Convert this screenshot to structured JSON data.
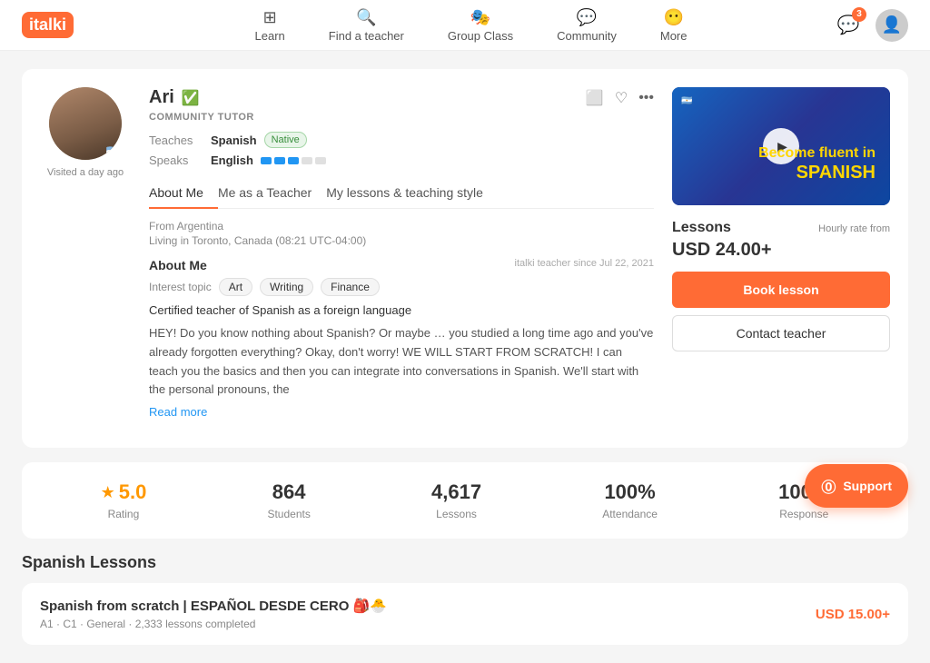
{
  "header": {
    "logo": "italki",
    "nav": [
      {
        "id": "learn",
        "label": "Learn",
        "icon": "📊"
      },
      {
        "id": "find-teacher",
        "label": "Find a teacher",
        "icon": "🔍"
      },
      {
        "id": "group-class",
        "label": "Group Class",
        "icon": "🎭"
      },
      {
        "id": "community",
        "label": "Community",
        "icon": "💬"
      },
      {
        "id": "more",
        "label": "More",
        "icon": "😶"
      }
    ],
    "notifications_count": "3"
  },
  "profile": {
    "name": "Ari",
    "verified": true,
    "tutor_type": "COMMUNITY TUTOR",
    "visited": "Visited a day ago",
    "teaches_label": "Teaches",
    "teaches_lang": "Spanish",
    "native_label": "Native",
    "speaks_label": "Speaks",
    "speaks_lang": "English",
    "flag": "🇦🇷",
    "italki_since": "italki teacher since Jul 22, 2021",
    "from": "From Argentina",
    "living": "Living in Toronto, Canada (08:21 UTC-04:00)",
    "about_title": "About Me",
    "interest_label": "Interest topic",
    "interests": [
      "Art",
      "Writing",
      "Finance"
    ],
    "certified": "Certified teacher of Spanish as a foreign language",
    "bio": "HEY! Do you know nothing about Spanish? Or maybe … you studied a long time ago and you've already forgotten everything? Okay, don't worry! WE WILL START FROM SCRATCH! I can teach you the basics and then you can integrate into conversations in Spanish. We'll start with the personal pronouns, the",
    "read_more": "Read more",
    "tabs": [
      {
        "id": "about",
        "label": "About Me",
        "active": true
      },
      {
        "id": "teacher",
        "label": "Me as a Teacher",
        "active": false
      },
      {
        "id": "lessons",
        "label": "My lessons & teaching style",
        "active": false
      }
    ]
  },
  "sidebar": {
    "hourly_label": "Hourly rate from",
    "price": "USD 24.00+",
    "lessons_title": "Lessons",
    "book_label": "Book lesson",
    "contact_label": "Contact teacher",
    "video_text": "Become fluent in\nSPANISH"
  },
  "stats": [
    {
      "id": "rating",
      "value": "5.0",
      "label": "Rating",
      "star": true
    },
    {
      "id": "students",
      "value": "864",
      "label": "Students"
    },
    {
      "id": "lessons",
      "value": "4,617",
      "label": "Lessons"
    },
    {
      "id": "attendance",
      "value": "100%",
      "label": "Attendance"
    },
    {
      "id": "response",
      "value": "100%",
      "label": "Response"
    }
  ],
  "spanish_lessons": {
    "section_title": "Spanish Lessons",
    "lesson_card": {
      "name": "Spanish from scratch | ESPAÑOL DESDE CERO 🎒🐣",
      "meta": "A1 · C1 · General · 2,333 lessons completed",
      "price": "USD 15.00+"
    }
  },
  "support": {
    "label": "Support"
  }
}
